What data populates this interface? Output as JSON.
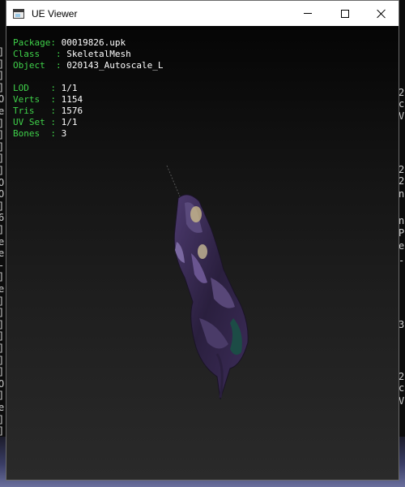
{
  "window": {
    "title": "UE Viewer"
  },
  "info": {
    "object_rows": [
      {
        "label": "Package: ",
        "value": "00019826.upk"
      },
      {
        "label": "Class   : ",
        "value": "SkeletalMesh"
      },
      {
        "label": "Object  : ",
        "value": "020143_Autoscale_L"
      }
    ],
    "mesh_rows": [
      {
        "label": "LOD    : ",
        "value": "1/1"
      },
      {
        "label": "Verts  : ",
        "value": "1154"
      },
      {
        "label": "Tris   : ",
        "value": "1576"
      },
      {
        "label": "UV Set : ",
        "value": "1/1"
      },
      {
        "label": "Bones  : ",
        "value": "3"
      }
    ]
  },
  "background_console": {
    "left_chars": [
      "]",
      "]",
      "]",
      "]",
      "O",
      "e",
      "]",
      "]",
      "]",
      "]",
      "]",
      "O",
      "O",
      "]",
      "6",
      "]",
      "e",
      "e",
      "-",
      "]",
      "e",
      "]",
      "]",
      "]",
      "]",
      "]",
      "]",
      "]",
      "O",
      "]",
      "e",
      "]",
      "]"
    ],
    "right_chars": [
      "2",
      "c",
      "V",
      "2",
      "2",
      "n",
      "n",
      "P",
      "e",
      "-",
      "3",
      "2",
      "c",
      "V"
    ]
  },
  "colors": {
    "label": "#3fd24a",
    "value": "#ffffff",
    "viewport_bg": "#202020",
    "titlebar_bg": "#ffffff"
  }
}
